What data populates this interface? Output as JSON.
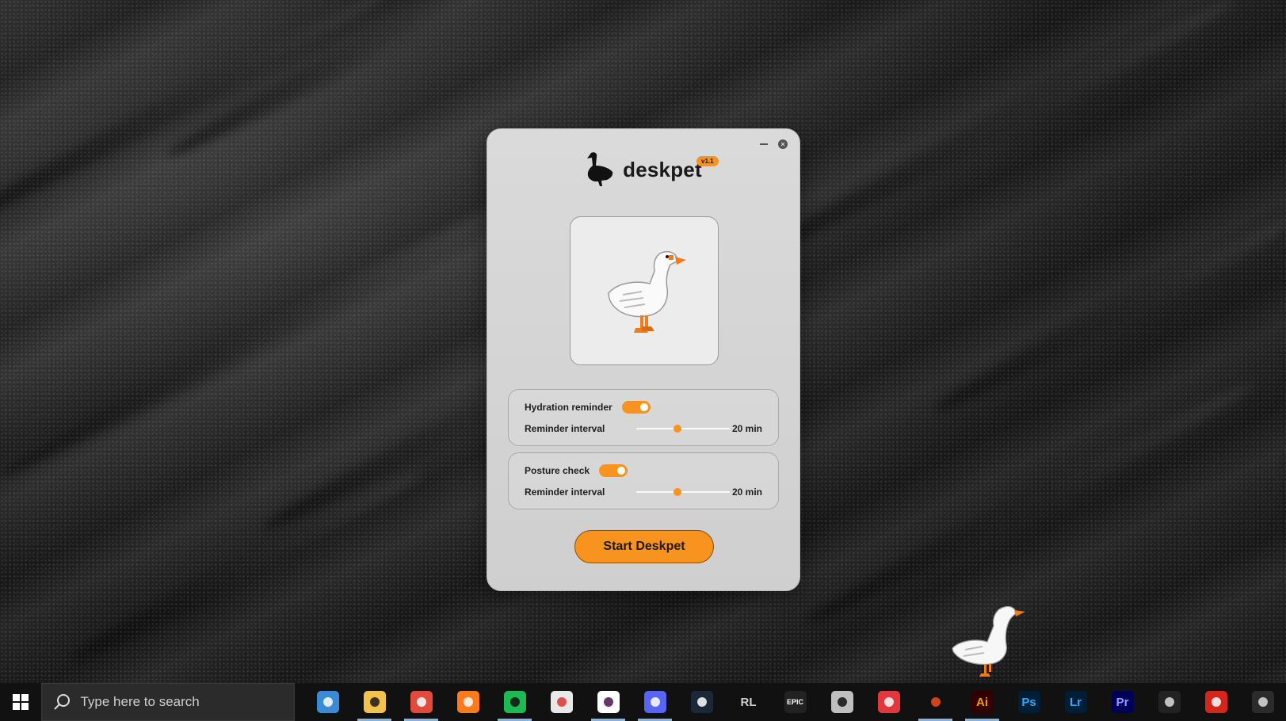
{
  "app": {
    "name": "deskpet",
    "version": "v1.1",
    "hydration": {
      "label": "Hydration reminder",
      "enabled": true,
      "interval_label": "Reminder interval",
      "interval_value": "20 min",
      "slider_fraction": 0.44
    },
    "posture": {
      "label": "Posture check",
      "enabled": true,
      "interval_label": "Reminder interval",
      "interval_value": "20 min",
      "slider_fraction": 0.44
    },
    "start_label": "Start Deskpet"
  },
  "taskbar": {
    "search_placeholder": "Type here to search",
    "apps": [
      {
        "name": "control-panel-icon",
        "text": "",
        "color": "#3a8ad6",
        "fg": "#fff"
      },
      {
        "name": "file-explorer-icon",
        "text": "",
        "color": "#f2c14e",
        "fg": "#1a1a1a"
      },
      {
        "name": "chrome-icon",
        "text": "",
        "color": "#e14b3b",
        "fg": "#fff"
      },
      {
        "name": "firefox-icon",
        "text": "",
        "color": "#ff7a1a",
        "fg": "#fff"
      },
      {
        "name": "spotify-icon",
        "text": "",
        "color": "#1db954",
        "fg": "#111"
      },
      {
        "name": "davinci-resolve-icon",
        "text": "",
        "color": "#e8e8e8",
        "fg": "#d33"
      },
      {
        "name": "slack-icon",
        "text": "",
        "color": "#ffffff",
        "fg": "#4a154b"
      },
      {
        "name": "discord-icon",
        "text": "",
        "color": "#5865f2",
        "fg": "#fff"
      },
      {
        "name": "steam-icon",
        "text": "",
        "color": "#1b2838",
        "fg": "#fff"
      },
      {
        "name": "rl-icon",
        "text": "RL",
        "color": "#111111",
        "fg": "#cfcfcf"
      },
      {
        "name": "epic-games-icon",
        "text": "EPIC",
        "color": "#222222",
        "fg": "#fff"
      },
      {
        "name": "minecraft-icon",
        "text": "",
        "color": "#bfbfbf",
        "fg": "#111"
      },
      {
        "name": "creative-cloud-icon",
        "text": "",
        "color": "#e2373f",
        "fg": "#fff"
      },
      {
        "name": "figma-icon",
        "text": "",
        "color": "#111111",
        "fg": "#f24e1e"
      },
      {
        "name": "illustrator-icon",
        "text": "Ai",
        "color": "#330000",
        "fg": "#ff9a00"
      },
      {
        "name": "photoshop-icon",
        "text": "Ps",
        "color": "#001e36",
        "fg": "#31a8ff"
      },
      {
        "name": "lightroom-icon",
        "text": "Lr",
        "color": "#001e36",
        "fg": "#31a8ff"
      },
      {
        "name": "premiere-icon",
        "text": "Pr",
        "color": "#00005b",
        "fg": "#9999ff"
      },
      {
        "name": "obs-icon",
        "text": "",
        "color": "#222222",
        "fg": "#ddd"
      },
      {
        "name": "acrobat-icon",
        "text": "",
        "color": "#d4261c",
        "fg": "#fff"
      },
      {
        "name": "terminal-icon",
        "text": "",
        "color": "#2b2b2b",
        "fg": "#ddd"
      }
    ]
  }
}
